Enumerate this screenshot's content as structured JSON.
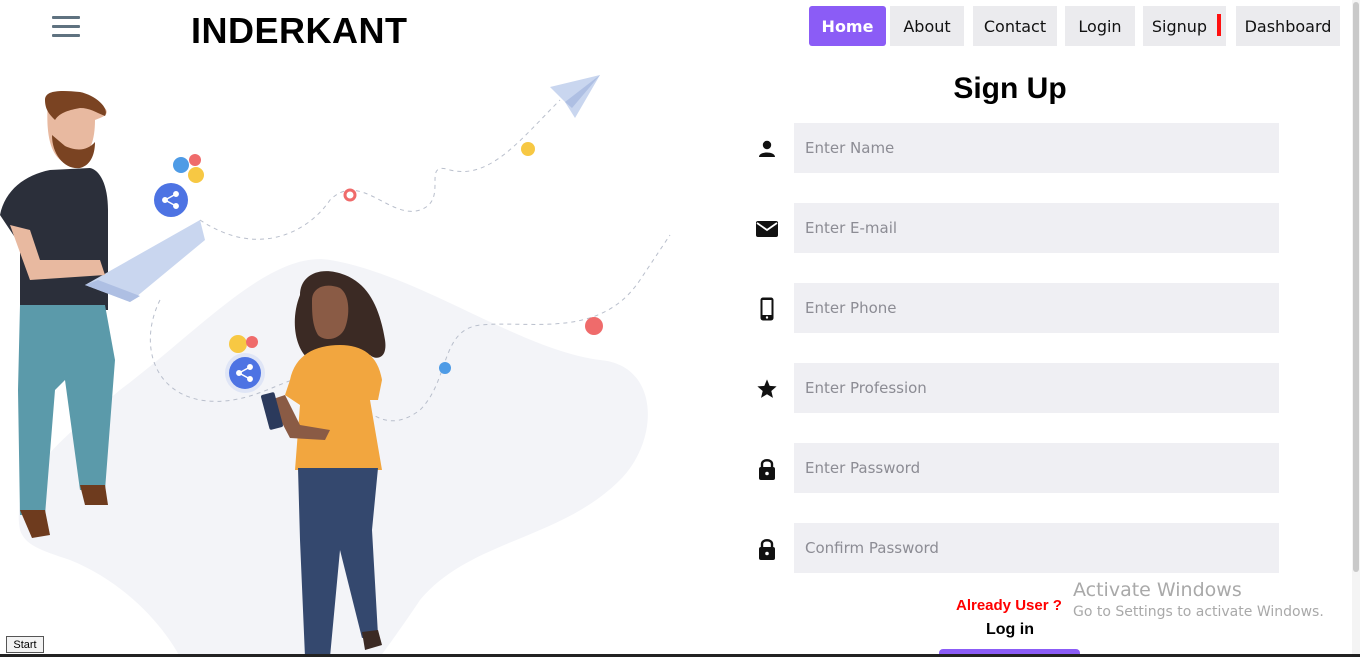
{
  "header": {
    "menu_icon": "hamburger-icon",
    "brand": "INDERKANT"
  },
  "nav": {
    "items": [
      {
        "label": "Home",
        "active": true
      },
      {
        "label": "About",
        "active": false
      },
      {
        "label": "Contact",
        "active": false
      },
      {
        "label": "Login",
        "active": false
      },
      {
        "label": "Signup",
        "active": false
      },
      {
        "label": "Dashboard",
        "active": false
      }
    ]
  },
  "form": {
    "title": "Sign Up",
    "fields": [
      {
        "icon": "person-icon",
        "placeholder": "Enter Name",
        "value": ""
      },
      {
        "icon": "email-icon",
        "placeholder": "Enter E-mail",
        "value": ""
      },
      {
        "icon": "phone-icon",
        "placeholder": "Enter Phone",
        "value": ""
      },
      {
        "icon": "star-icon",
        "placeholder": "Enter Profession",
        "value": ""
      },
      {
        "icon": "lock-icon",
        "placeholder": "Enter Password",
        "value": ""
      },
      {
        "icon": "lock-icon",
        "placeholder": "Confirm Password",
        "value": ""
      }
    ],
    "already_user": "Already User ?",
    "login_link": "Log in"
  },
  "watermark": {
    "line1": "Activate Windows",
    "line2": "Go to Settings to activate Windows."
  },
  "taskbar": {
    "start_label": "Start"
  },
  "colors": {
    "accent": "#8b5cf6",
    "input_bg": "#efeff3",
    "alert_red": "#ff0000"
  }
}
